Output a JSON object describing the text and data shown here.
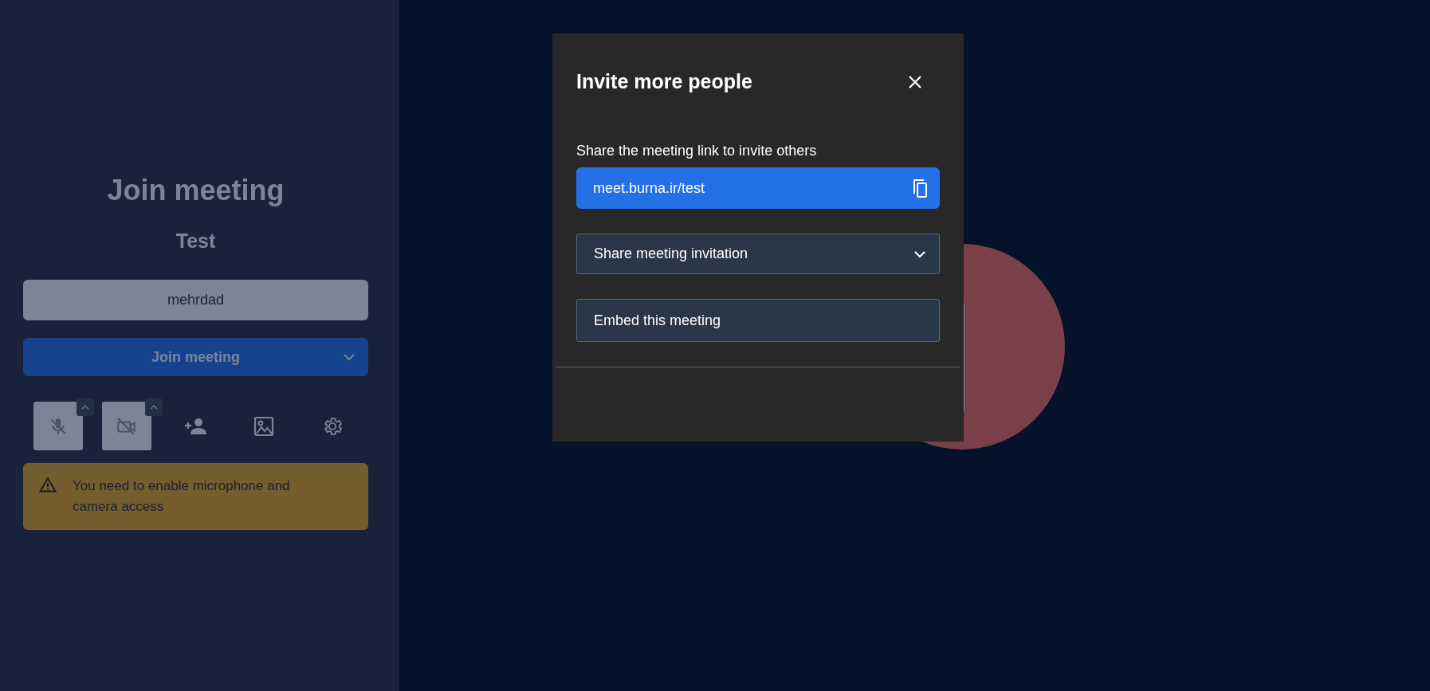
{
  "prejoin": {
    "title": "Join meeting",
    "meeting_name": "Test",
    "name_field": {
      "value": "mehrdad"
    },
    "join_button": {
      "label": "Join meeting"
    },
    "toolbar": [
      {
        "kind": "mic",
        "off": true
      },
      {
        "kind": "camera",
        "off": true
      },
      {
        "kind": "invite"
      },
      {
        "kind": "background"
      },
      {
        "kind": "settings"
      }
    ],
    "warning": "You need to enable microphone and camera access"
  },
  "dialog": {
    "title": "Invite more people",
    "link_label": "Share the meeting link to invite others",
    "link": "meet.burna.ir/test",
    "share_dropdown": {
      "label": "Share meeting invitation",
      "expanded": false
    },
    "embed_button": {
      "label": "Embed this meeting"
    }
  }
}
